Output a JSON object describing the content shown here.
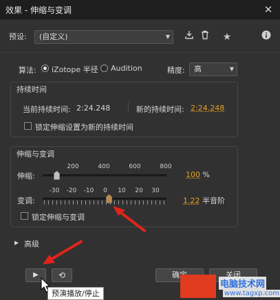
{
  "window": {
    "title": "效果 - 伸缩与变调",
    "close_glyph": "✕"
  },
  "preset": {
    "label": "预设:",
    "value": "(自定义)"
  },
  "algorithm": {
    "label": "算法:",
    "options": [
      "iZotope 半径",
      "Audition"
    ],
    "selected": "iZotope 半径",
    "precision_label": "精度:",
    "precision_value": "高"
  },
  "duration": {
    "group_title": "持续时间",
    "current_label": "当前持续时间:",
    "current_value": "2:24.248",
    "new_label": "新的持续时间:",
    "new_value": "2:24.248",
    "lock_label": "锁定伸缩设置为新的持续时间"
  },
  "stretch_pitch": {
    "group_title": "伸缩与变调",
    "stretch_label": "伸缩:",
    "stretch_ticks": [
      "200",
      "400",
      "600",
      "800"
    ],
    "stretch_value": "100",
    "stretch_unit": "%",
    "stretch_fraction": 0.0,
    "pitch_label": "变调:",
    "pitch_ticks": [
      "-30",
      "-20",
      "-10",
      "0",
      "10",
      "20",
      "30"
    ],
    "pitch_value": "1.22",
    "pitch_unit": "半音阶",
    "pitch_fraction": 0.5,
    "lock_label": "锁定伸缩与变调"
  },
  "advanced": {
    "label": "高级"
  },
  "buttons": {
    "play_glyph": "▶",
    "loop_glyph": "⟲",
    "ok": "确定",
    "close": "关闭"
  },
  "tooltip": "预演播放/停止",
  "watermark": {
    "logo": "TAG",
    "text": "电脑技术网",
    "url": "www.tagxp.com"
  },
  "colors": {
    "accent_orange": "#e8a21e",
    "annotation_red": "#e0241b"
  }
}
